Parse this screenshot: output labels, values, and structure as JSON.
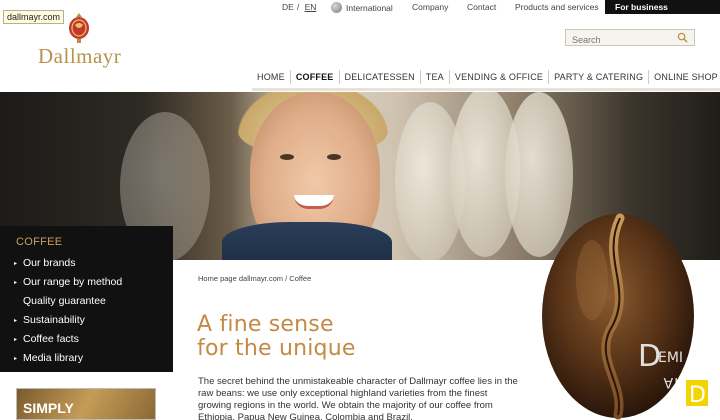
{
  "tooltip": {
    "url": "dallmayr.com"
  },
  "brand": {
    "name": "Dallmayr"
  },
  "topbar": {
    "lang_de": "DE",
    "lang_sep": "/",
    "lang_en": "EN",
    "international": "International",
    "company": "Company",
    "contact": "Contact",
    "products": "Products and services",
    "business": "For business customers"
  },
  "search": {
    "placeholder": "Search"
  },
  "nav": {
    "items": [
      {
        "label": "HOME"
      },
      {
        "label": "COFFEE"
      },
      {
        "label": "DELICATESSEN"
      },
      {
        "label": "TEA"
      },
      {
        "label": "VENDING & OFFICE"
      },
      {
        "label": "PARTY & CATERING"
      },
      {
        "label": "ONLINE SHOP"
      }
    ],
    "active": "COFFEE"
  },
  "sidebar": {
    "title": "COFFEE",
    "items": [
      {
        "label": "Our brands"
      },
      {
        "label": "Our range by method"
      },
      {
        "label": "Quality guarantee"
      },
      {
        "label": "Sustainability"
      },
      {
        "label": "Coffee facts"
      },
      {
        "label": "Media library"
      }
    ]
  },
  "promo": {
    "label": "SIMPLY"
  },
  "content": {
    "breadcrumb": "Home page dallmayr.com / Coffee",
    "headline_line1": "A fine sense",
    "headline_line2": "for the unique",
    "body": "The secret behind the unmistakeable character of Dallmayr coffee lies in the raw beans: we use only exceptional highland varieties from the finest growing regions in the world. We obtain the majority of our coffee from Ethiopia, Papua New Guinea, Colombia and Brazil."
  },
  "colors": {
    "accent_gold": "#c48a44",
    "sidebar_bg": "#111111",
    "sidebar_title": "#c8a160",
    "business_button_bg": "#111111"
  }
}
